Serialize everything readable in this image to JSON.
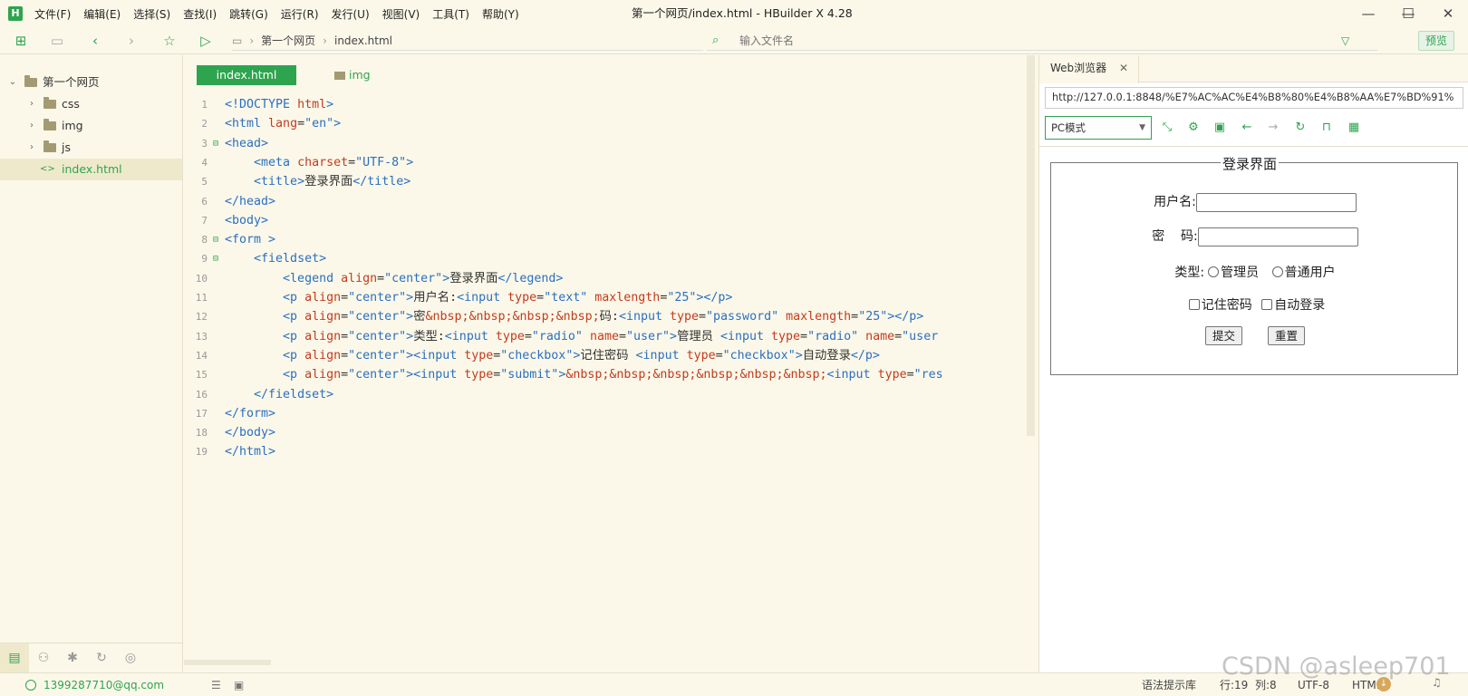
{
  "window": {
    "app_logo": "H",
    "title": "第一个网页/index.html - HBuilder X 4.28",
    "menu": [
      "文件(F)",
      "编辑(E)",
      "选择(S)",
      "查找(I)",
      "跳转(G)",
      "运行(R)",
      "发行(U)",
      "视图(V)",
      "工具(T)",
      "帮助(Y)"
    ],
    "controls": {
      "minimize": "—",
      "maximize": "☐",
      "close": "✕"
    }
  },
  "toolbar": {
    "breadcrumb": [
      "第一个网页",
      "index.html"
    ],
    "file_search_placeholder": "输入文件名",
    "preview_label": "预览"
  },
  "sidebar": {
    "project": "第一个网页",
    "items": [
      {
        "label": "css",
        "type": "folder"
      },
      {
        "label": "img",
        "type": "folder"
      },
      {
        "label": "js",
        "type": "folder"
      },
      {
        "label": "index.html",
        "type": "file"
      }
    ]
  },
  "editor": {
    "tabs": [
      "index.html",
      "img"
    ],
    "lines": [
      [
        {
          "t": "tag",
          "v": "<!DOCTYPE "
        },
        {
          "t": "attr",
          "v": "html"
        },
        {
          "t": "tag",
          "v": ">"
        }
      ],
      [
        {
          "t": "tag",
          "v": "<html "
        },
        {
          "t": "attr",
          "v": "lang"
        },
        {
          "t": "txt",
          "v": "="
        },
        {
          "t": "str",
          "v": "\"en\""
        },
        {
          "t": "tag",
          "v": ">"
        }
      ],
      [
        {
          "t": "tag",
          "v": "<head>"
        }
      ],
      [
        {
          "t": "txt",
          "v": "    "
        },
        {
          "t": "tag",
          "v": "<meta "
        },
        {
          "t": "attr",
          "v": "charset"
        },
        {
          "t": "txt",
          "v": "="
        },
        {
          "t": "str",
          "v": "\"UTF-8\""
        },
        {
          "t": "tag",
          "v": ">"
        }
      ],
      [
        {
          "t": "txt",
          "v": "    "
        },
        {
          "t": "tag",
          "v": "<title>"
        },
        {
          "t": "txt",
          "v": "登录界面"
        },
        {
          "t": "tag",
          "v": "</title>"
        }
      ],
      [
        {
          "t": "tag",
          "v": "</head>"
        }
      ],
      [
        {
          "t": "tag",
          "v": "<body>"
        }
      ],
      [
        {
          "t": "tag",
          "v": "<form >"
        }
      ],
      [
        {
          "t": "txt",
          "v": "    "
        },
        {
          "t": "tag",
          "v": "<fieldset>"
        }
      ],
      [
        {
          "t": "txt",
          "v": "        "
        },
        {
          "t": "tag",
          "v": "<legend "
        },
        {
          "t": "attr",
          "v": "align"
        },
        {
          "t": "txt",
          "v": "="
        },
        {
          "t": "str",
          "v": "\"center\""
        },
        {
          "t": "tag",
          "v": ">"
        },
        {
          "t": "txt",
          "v": "登录界面"
        },
        {
          "t": "tag",
          "v": "</legend>"
        }
      ],
      [
        {
          "t": "txt",
          "v": "        "
        },
        {
          "t": "tag",
          "v": "<p "
        },
        {
          "t": "attr",
          "v": "align"
        },
        {
          "t": "txt",
          "v": "="
        },
        {
          "t": "str",
          "v": "\"center\""
        },
        {
          "t": "tag",
          "v": ">"
        },
        {
          "t": "txt",
          "v": "用户名:"
        },
        {
          "t": "tag",
          "v": "<input "
        },
        {
          "t": "attr",
          "v": "type"
        },
        {
          "t": "txt",
          "v": "="
        },
        {
          "t": "str",
          "v": "\"text\""
        },
        {
          "t": "txt",
          "v": " "
        },
        {
          "t": "attr",
          "v": "maxlength"
        },
        {
          "t": "txt",
          "v": "="
        },
        {
          "t": "str",
          "v": "\"25\""
        },
        {
          "t": "tag",
          "v": "></p>"
        }
      ],
      [
        {
          "t": "txt",
          "v": "        "
        },
        {
          "t": "tag",
          "v": "<p "
        },
        {
          "t": "attr",
          "v": "align"
        },
        {
          "t": "txt",
          "v": "="
        },
        {
          "t": "str",
          "v": "\"center\""
        },
        {
          "t": "tag",
          "v": ">"
        },
        {
          "t": "txt",
          "v": "密"
        },
        {
          "t": "attr",
          "v": "&nbsp;&nbsp;&nbsp;&nbsp;"
        },
        {
          "t": "txt",
          "v": "码:"
        },
        {
          "t": "tag",
          "v": "<input "
        },
        {
          "t": "attr",
          "v": "type"
        },
        {
          "t": "txt",
          "v": "="
        },
        {
          "t": "str",
          "v": "\"password\""
        },
        {
          "t": "txt",
          "v": " "
        },
        {
          "t": "attr",
          "v": "maxlength"
        },
        {
          "t": "txt",
          "v": "="
        },
        {
          "t": "str",
          "v": "\"25\""
        },
        {
          "t": "tag",
          "v": "></p>"
        }
      ],
      [
        {
          "t": "txt",
          "v": "        "
        },
        {
          "t": "tag",
          "v": "<p "
        },
        {
          "t": "attr",
          "v": "align"
        },
        {
          "t": "txt",
          "v": "="
        },
        {
          "t": "str",
          "v": "\"center\""
        },
        {
          "t": "tag",
          "v": ">"
        },
        {
          "t": "txt",
          "v": "类型:"
        },
        {
          "t": "tag",
          "v": "<input "
        },
        {
          "t": "attr",
          "v": "type"
        },
        {
          "t": "txt",
          "v": "="
        },
        {
          "t": "str",
          "v": "\"radio\""
        },
        {
          "t": "txt",
          "v": " "
        },
        {
          "t": "attr",
          "v": "name"
        },
        {
          "t": "txt",
          "v": "="
        },
        {
          "t": "str",
          "v": "\"user\""
        },
        {
          "t": "tag",
          "v": ">"
        },
        {
          "t": "txt",
          "v": "管理员 "
        },
        {
          "t": "tag",
          "v": "<input "
        },
        {
          "t": "attr",
          "v": "type"
        },
        {
          "t": "txt",
          "v": "="
        },
        {
          "t": "str",
          "v": "\"radio\""
        },
        {
          "t": "txt",
          "v": " "
        },
        {
          "t": "attr",
          "v": "name"
        },
        {
          "t": "txt",
          "v": "="
        },
        {
          "t": "str",
          "v": "\"user"
        }
      ],
      [
        {
          "t": "txt",
          "v": "        "
        },
        {
          "t": "tag",
          "v": "<p "
        },
        {
          "t": "attr",
          "v": "align"
        },
        {
          "t": "txt",
          "v": "="
        },
        {
          "t": "str",
          "v": "\"center\""
        },
        {
          "t": "tag",
          "v": "><input "
        },
        {
          "t": "attr",
          "v": "type"
        },
        {
          "t": "txt",
          "v": "="
        },
        {
          "t": "str",
          "v": "\"checkbox\""
        },
        {
          "t": "tag",
          "v": ">"
        },
        {
          "t": "txt",
          "v": "记住密码 "
        },
        {
          "t": "tag",
          "v": "<input "
        },
        {
          "t": "attr",
          "v": "type"
        },
        {
          "t": "txt",
          "v": "="
        },
        {
          "t": "str",
          "v": "\"checkbox\""
        },
        {
          "t": "tag",
          "v": ">"
        },
        {
          "t": "txt",
          "v": "自动登录"
        },
        {
          "t": "tag",
          "v": "</p>"
        }
      ],
      [
        {
          "t": "txt",
          "v": "        "
        },
        {
          "t": "tag",
          "v": "<p "
        },
        {
          "t": "attr",
          "v": "align"
        },
        {
          "t": "txt",
          "v": "="
        },
        {
          "t": "str",
          "v": "\"center\""
        },
        {
          "t": "tag",
          "v": "><input "
        },
        {
          "t": "attr",
          "v": "type"
        },
        {
          "t": "txt",
          "v": "="
        },
        {
          "t": "str",
          "v": "\"submit\""
        },
        {
          "t": "tag",
          "v": ">"
        },
        {
          "t": "attr",
          "v": "&nbsp;&nbsp;&nbsp;&nbsp;&nbsp;&nbsp;"
        },
        {
          "t": "tag",
          "v": "<input "
        },
        {
          "t": "attr",
          "v": "type"
        },
        {
          "t": "txt",
          "v": "="
        },
        {
          "t": "str",
          "v": "\"res"
        }
      ],
      [
        {
          "t": "txt",
          "v": "    "
        },
        {
          "t": "tag",
          "v": "</fieldset>"
        }
      ],
      [
        {
          "t": "tag",
          "v": "</form>"
        }
      ],
      [
        {
          "t": "tag",
          "v": "</body>"
        }
      ],
      [
        {
          "t": "tag",
          "v": "</html>"
        }
      ]
    ]
  },
  "browser": {
    "tab_label": "Web浏览器",
    "url": "http://127.0.0.1:8848/%E7%AC%AC%E4%B8%80%E4%B8%AA%E7%BD%91%",
    "mode": "PC模式",
    "page": {
      "legend": "登录界面",
      "username_label": "用户名:",
      "password_label": "密    码:",
      "type_label": "类型:",
      "radio_admin": "管理员",
      "radio_user": "普通用户",
      "check_remember": "记住密码",
      "check_auto": "自动登录",
      "submit": "提交",
      "reset": "重置"
    }
  },
  "statusbar": {
    "user": "1399287710@qq.com",
    "syntax_hint": "语法提示库",
    "position": "行:19  列:8",
    "encoding": "UTF-8",
    "language": "HTML",
    "watermark": "CSDN @asleep701"
  },
  "colors": {
    "accent": "#2ea44f",
    "background": "#fbf8e9",
    "tag": "#2b6fc1",
    "attr": "#c33b1e"
  }
}
